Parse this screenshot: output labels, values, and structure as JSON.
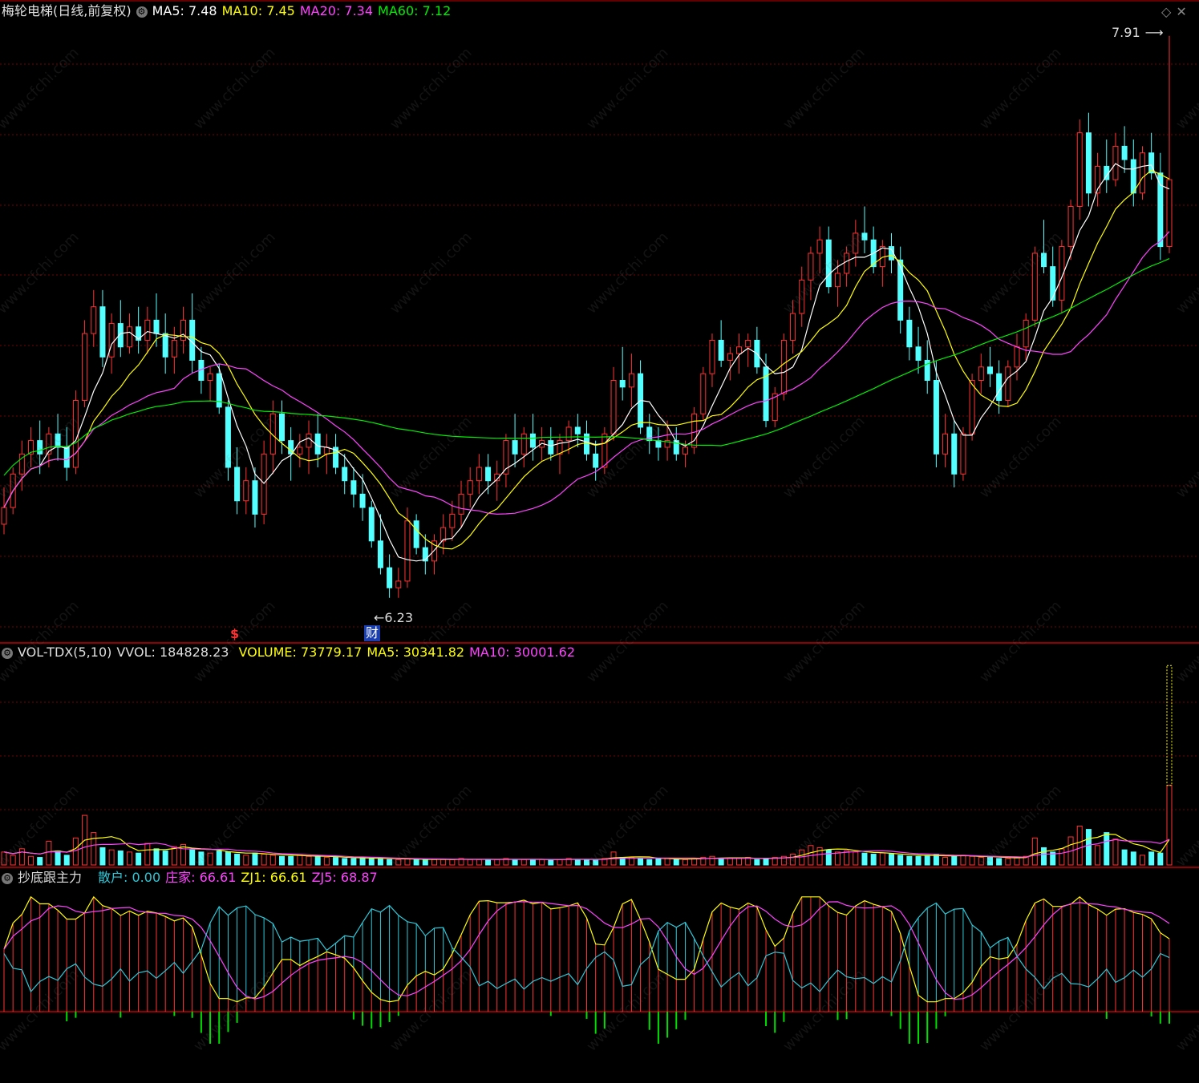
{
  "panels": {
    "main": {
      "title": "梅轮电梯(日线,前复权)",
      "ma": [
        {
          "label": "MA5: 7.48",
          "color": "#ffffff"
        },
        {
          "label": "MA10: 7.45",
          "color": "#ffff00"
        },
        {
          "label": "MA20: 7.34",
          "color": "#ff44ff"
        },
        {
          "label": "MA60: 7.12",
          "color": "#00ee00"
        }
      ],
      "high_label": "7.91",
      "low_label": "6.23",
      "marker_s": "$",
      "marker_cai": "财"
    },
    "volume": {
      "title": "VOL-TDX(5,10)",
      "vvol": "VVOL: 184828.23",
      "volume": "VOLUME: 73779.17",
      "ma5": "MA5: 30341.82",
      "ma10": "MA10: 30001.62"
    },
    "indicator": {
      "title": "抄底跟主力",
      "sanhu": "散户: 0.00",
      "zhuangjia": "庄家: 66.61",
      "zj1": "ZJ1: 66.61",
      "zj5": "ZJ5: 68.87"
    }
  },
  "watermark": "www.cfchi.com",
  "colors": {
    "up": "#ff3232",
    "down": "#54ffff",
    "ma5": "#ffffff",
    "ma10": "#ffff00",
    "ma20": "#ff44ff",
    "ma60": "#00ee00",
    "grid": "#7a0000",
    "cyan_line": "#2fc8d8"
  },
  "chart_data": {
    "type": "candlestick",
    "price_range": [
      6.23,
      7.91
    ],
    "candles_ohlc": [
      [
        6.45,
        6.56,
        6.42,
        6.5
      ],
      [
        6.5,
        6.62,
        6.48,
        6.6
      ],
      [
        6.6,
        6.7,
        6.55,
        6.66
      ],
      [
        6.66,
        6.74,
        6.62,
        6.7
      ],
      [
        6.7,
        6.76,
        6.6,
        6.66
      ],
      [
        6.66,
        6.74,
        6.62,
        6.72
      ],
      [
        6.72,
        6.78,
        6.64,
        6.68
      ],
      [
        6.68,
        6.74,
        6.58,
        6.62
      ],
      [
        6.62,
        6.85,
        6.6,
        6.82
      ],
      [
        6.82,
        7.06,
        6.8,
        7.02
      ],
      [
        7.02,
        7.15,
        6.98,
        7.1
      ],
      [
        7.1,
        7.15,
        6.92,
        6.95
      ],
      [
        6.95,
        7.08,
        6.9,
        7.05
      ],
      [
        7.05,
        7.12,
        6.95,
        6.98
      ],
      [
        6.98,
        7.08,
        6.96,
        7.04
      ],
      [
        7.04,
        7.1,
        6.96,
        7.0
      ],
      [
        7.0,
        7.1,
        6.96,
        7.06
      ],
      [
        7.06,
        7.14,
        6.98,
        7.02
      ],
      [
        7.02,
        7.08,
        6.9,
        6.95
      ],
      [
        6.95,
        7.04,
        6.9,
        7.0
      ],
      [
        7.0,
        7.1,
        6.96,
        7.06
      ],
      [
        7.06,
        7.14,
        6.9,
        6.94
      ],
      [
        6.94,
        6.98,
        6.84,
        6.88
      ],
      [
        6.88,
        6.92,
        6.82,
        6.9
      ],
      [
        6.9,
        6.93,
        6.78,
        6.8
      ],
      [
        6.8,
        6.82,
        6.58,
        6.62
      ],
      [
        6.62,
        6.68,
        6.48,
        6.52
      ],
      [
        6.52,
        6.62,
        6.48,
        6.58
      ],
      [
        6.58,
        6.62,
        6.44,
        6.48
      ],
      [
        6.48,
        6.7,
        6.45,
        6.66
      ],
      [
        6.66,
        6.82,
        6.6,
        6.78
      ],
      [
        6.78,
        6.82,
        6.66,
        6.7
      ],
      [
        6.7,
        6.74,
        6.58,
        6.66
      ],
      [
        6.66,
        6.72,
        6.62,
        6.68
      ],
      [
        6.68,
        6.76,
        6.6,
        6.72
      ],
      [
        6.72,
        6.78,
        6.62,
        6.66
      ],
      [
        6.66,
        6.72,
        6.6,
        6.68
      ],
      [
        6.68,
        6.72,
        6.6,
        6.62
      ],
      [
        6.62,
        6.66,
        6.54,
        6.58
      ],
      [
        6.58,
        6.62,
        6.5,
        6.54
      ],
      [
        6.54,
        6.6,
        6.46,
        6.5
      ],
      [
        6.5,
        6.52,
        6.38,
        6.4
      ],
      [
        6.4,
        6.48,
        6.3,
        6.32
      ],
      [
        6.32,
        6.36,
        6.23,
        6.26
      ],
      [
        6.26,
        6.32,
        6.23,
        6.28
      ],
      [
        6.28,
        6.5,
        6.26,
        6.46
      ],
      [
        6.46,
        6.48,
        6.36,
        6.38
      ],
      [
        6.38,
        6.42,
        6.3,
        6.34
      ],
      [
        6.34,
        6.42,
        6.3,
        6.4
      ],
      [
        6.4,
        6.48,
        6.36,
        6.44
      ],
      [
        6.44,
        6.52,
        6.4,
        6.48
      ],
      [
        6.48,
        6.58,
        6.44,
        6.54
      ],
      [
        6.54,
        6.62,
        6.5,
        6.58
      ],
      [
        6.58,
        6.66,
        6.54,
        6.62
      ],
      [
        6.62,
        6.66,
        6.54,
        6.58
      ],
      [
        6.58,
        6.64,
        6.52,
        6.6
      ],
      [
        6.6,
        6.72,
        6.56,
        6.7
      ],
      [
        6.7,
        6.78,
        6.62,
        6.66
      ],
      [
        6.66,
        6.74,
        6.62,
        6.72
      ],
      [
        6.72,
        6.78,
        6.64,
        6.68
      ],
      [
        6.68,
        6.74,
        6.64,
        6.7
      ],
      [
        6.7,
        6.74,
        6.64,
        6.66
      ],
      [
        6.66,
        6.72,
        6.6,
        6.7
      ],
      [
        6.7,
        6.76,
        6.66,
        6.74
      ],
      [
        6.74,
        6.78,
        6.68,
        6.72
      ],
      [
        6.72,
        6.76,
        6.64,
        6.66
      ],
      [
        6.66,
        6.7,
        6.58,
        6.62
      ],
      [
        6.62,
        6.74,
        6.6,
        6.72
      ],
      [
        6.72,
        6.92,
        6.7,
        6.88
      ],
      [
        6.88,
        6.98,
        6.82,
        6.86
      ],
      [
        6.86,
        6.96,
        6.8,
        6.9
      ],
      [
        6.9,
        6.94,
        6.72,
        6.74
      ],
      [
        6.74,
        6.78,
        6.66,
        6.7
      ],
      [
        6.7,
        6.74,
        6.64,
        6.68
      ],
      [
        6.68,
        6.76,
        6.64,
        6.7
      ],
      [
        6.7,
        6.74,
        6.64,
        6.66
      ],
      [
        6.66,
        6.7,
        6.62,
        6.68
      ],
      [
        6.68,
        6.8,
        6.66,
        6.78
      ],
      [
        6.78,
        6.92,
        6.76,
        6.9
      ],
      [
        6.9,
        7.02,
        6.86,
        7.0
      ],
      [
        7.0,
        7.06,
        6.92,
        6.94
      ],
      [
        6.94,
        6.98,
        6.88,
        6.96
      ],
      [
        6.96,
        7.02,
        6.9,
        6.98
      ],
      [
        6.98,
        7.02,
        6.92,
        7.0
      ],
      [
        7.0,
        7.04,
        6.9,
        6.92
      ],
      [
        6.92,
        6.96,
        6.74,
        6.76
      ],
      [
        6.76,
        6.86,
        6.74,
        6.84
      ],
      [
        6.84,
        7.02,
        6.82,
        7.0
      ],
      [
        7.0,
        7.12,
        6.96,
        7.08
      ],
      [
        7.08,
        7.22,
        7.04,
        7.18
      ],
      [
        7.18,
        7.28,
        7.12,
        7.26
      ],
      [
        7.26,
        7.34,
        7.2,
        7.3
      ],
      [
        7.3,
        7.34,
        7.14,
        7.16
      ],
      [
        7.16,
        7.24,
        7.1,
        7.2
      ],
      [
        7.2,
        7.28,
        7.16,
        7.26
      ],
      [
        7.26,
        7.36,
        7.22,
        7.32
      ],
      [
        7.32,
        7.4,
        7.26,
        7.3
      ],
      [
        7.3,
        7.34,
        7.2,
        7.22
      ],
      [
        7.22,
        7.3,
        7.16,
        7.28
      ],
      [
        7.28,
        7.32,
        7.2,
        7.24
      ],
      [
        7.24,
        7.28,
        7.02,
        7.06
      ],
      [
        7.06,
        7.1,
        6.94,
        6.98
      ],
      [
        6.98,
        7.04,
        6.9,
        6.94
      ],
      [
        6.94,
        7.0,
        6.84,
        6.88
      ],
      [
        6.88,
        6.94,
        6.62,
        6.66
      ],
      [
        6.66,
        6.78,
        6.62,
        6.72
      ],
      [
        6.72,
        6.76,
        6.56,
        6.6
      ],
      [
        6.6,
        6.74,
        6.58,
        6.72
      ],
      [
        6.72,
        6.9,
        6.7,
        6.88
      ],
      [
        6.88,
        6.96,
        6.84,
        6.92
      ],
      [
        6.92,
        6.98,
        6.86,
        6.9
      ],
      [
        6.9,
        6.94,
        6.78,
        6.82
      ],
      [
        6.82,
        6.94,
        6.8,
        6.92
      ],
      [
        6.92,
        7.02,
        6.88,
        6.98
      ],
      [
        6.98,
        7.08,
        6.94,
        7.06
      ],
      [
        7.06,
        7.28,
        7.04,
        7.26
      ],
      [
        7.26,
        7.36,
        7.2,
        7.22
      ],
      [
        7.22,
        7.28,
        7.1,
        7.12
      ],
      [
        7.12,
        7.3,
        7.08,
        7.28
      ],
      [
        7.28,
        7.42,
        7.24,
        7.4
      ],
      [
        7.4,
        7.66,
        7.36,
        7.62
      ],
      [
        7.62,
        7.68,
        7.4,
        7.44
      ],
      [
        7.44,
        7.56,
        7.4,
        7.52
      ],
      [
        7.52,
        7.6,
        7.44,
        7.48
      ],
      [
        7.48,
        7.62,
        7.46,
        7.58
      ],
      [
        7.58,
        7.64,
        7.5,
        7.54
      ],
      [
        7.54,
        7.6,
        7.4,
        7.44
      ],
      [
        7.44,
        7.58,
        7.42,
        7.56
      ],
      [
        7.56,
        7.62,
        7.48,
        7.5
      ],
      [
        7.5,
        7.56,
        7.24,
        7.28
      ],
      [
        7.28,
        7.91,
        7.26,
        7.48
      ]
    ],
    "volume_range": [
      0,
      185000
    ],
    "volumes": [
      12000,
      9000,
      15000,
      8000,
      7000,
      22000,
      13000,
      9000,
      25000,
      46000,
      30000,
      16000,
      14000,
      13000,
      12000,
      11000,
      20000,
      15000,
      13000,
      17000,
      19000,
      14000,
      12000,
      11000,
      13000,
      12000,
      10000,
      9000,
      11000,
      10000,
      9000,
      8000,
      8000,
      9000,
      8000,
      8000,
      7000,
      7000,
      6000,
      6000,
      7000,
      6000,
      6000,
      5000,
      5000,
      6000,
      5000,
      5000,
      5000,
      5000,
      5000,
      6000,
      5000,
      5000,
      5000,
      5000,
      6000,
      5000,
      5000,
      5000,
      5000,
      5000,
      5000,
      6000,
      5000,
      5000,
      5000,
      6000,
      12000,
      7000,
      7000,
      6000,
      5000,
      6000,
      6000,
      5000,
      5000,
      6000,
      7000,
      8000,
      6000,
      6000,
      6000,
      7000,
      5000,
      6000,
      7000,
      8000,
      10000,
      14000,
      18000,
      16000,
      14000,
      12000,
      13000,
      12000,
      11000,
      10000,
      11000,
      10000,
      9000,
      8000,
      8000,
      9000,
      10000,
      7000,
      8000,
      9000,
      8000,
      7000,
      7000,
      6000,
      6000,
      7000,
      8000,
      25000,
      16000,
      12000,
      15000,
      26000,
      36000,
      33000,
      18000,
      30000,
      24000,
      14000,
      12000,
      9000,
      12000,
      11000,
      73779
    ],
    "vol_peak_value": 184828,
    "indicator_range": [
      -15,
      100
    ],
    "ma_periods": [
      5,
      10,
      20,
      60
    ]
  }
}
